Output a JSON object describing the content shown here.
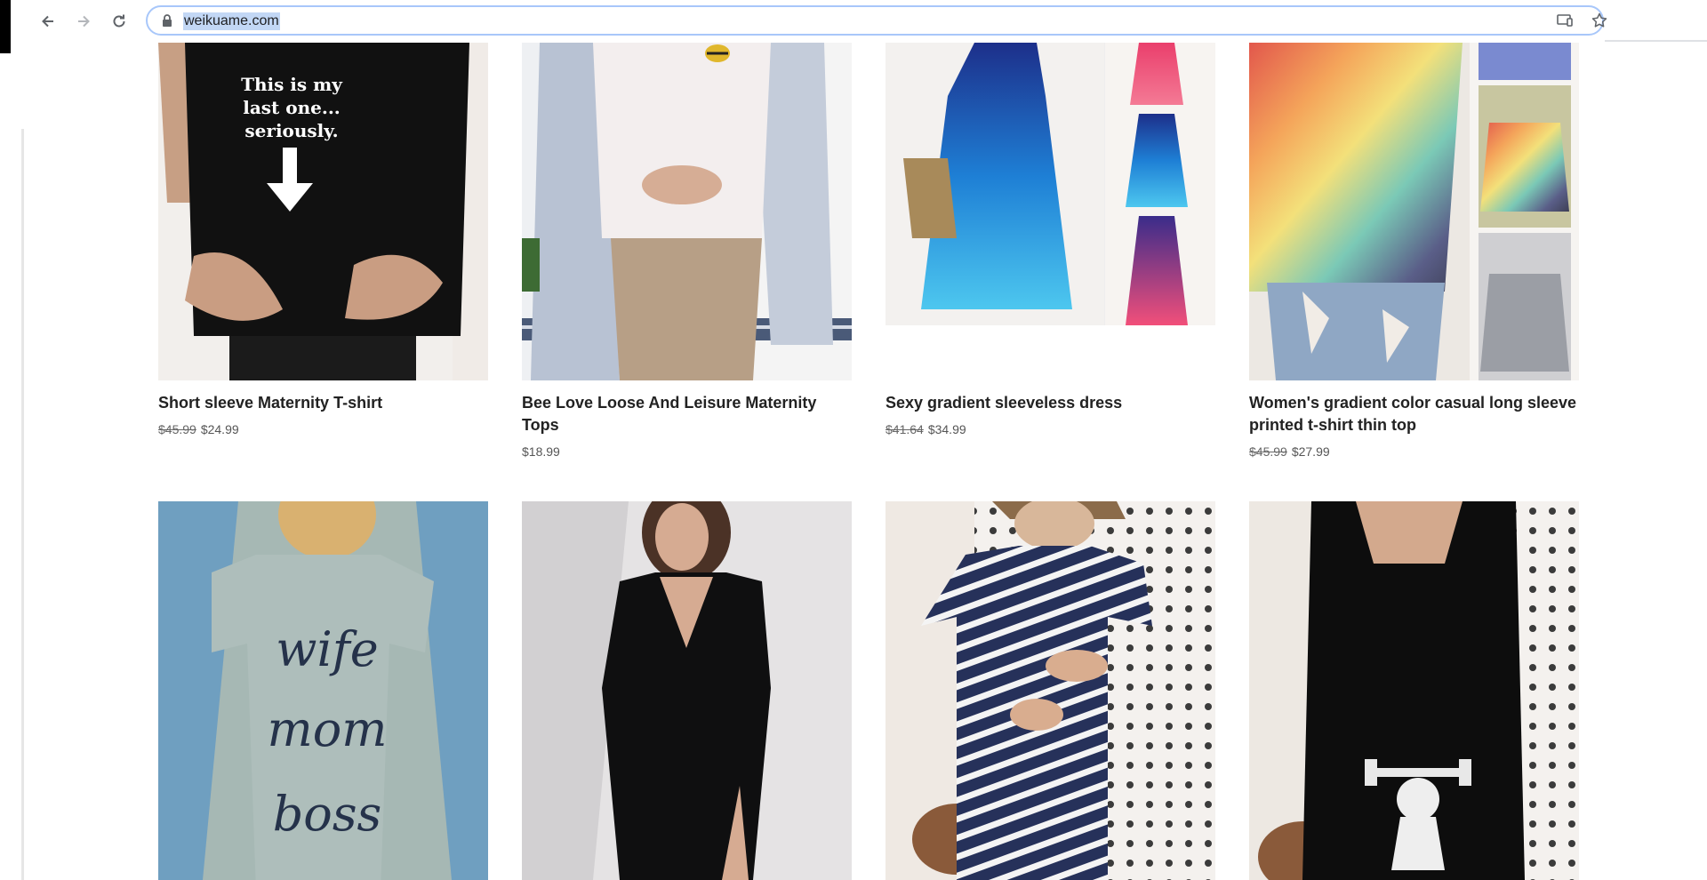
{
  "browser": {
    "url": "weikuame.com",
    "icons": {
      "back": "arrow-left-icon",
      "forward": "arrow-right-icon",
      "reload": "reload-icon",
      "lock": "lock-icon",
      "cast": "cast-icon",
      "bookmark": "star-icon"
    }
  },
  "products": [
    {
      "title": "Short sleeve Maternity T-shirt",
      "old_price": "$45.99",
      "price": "$24.99",
      "image_text": [
        "This is my",
        "last one...",
        "seriously."
      ]
    },
    {
      "title": "Bee Love Loose And Leisure Maternity Tops",
      "old_price": "",
      "price": "$18.99"
    },
    {
      "title": "Sexy gradient sleeveless dress",
      "old_price": "$41.64",
      "price": "$34.99"
    },
    {
      "title": "Women's gradient color casual long sleeve printed t-shirt thin top",
      "old_price": "$45.99",
      "price": "$27.99"
    },
    {
      "title": "",
      "image_text": [
        "wife",
        "mom",
        "boss"
      ]
    },
    {
      "title": ""
    },
    {
      "title": ""
    },
    {
      "title": ""
    }
  ],
  "colors": {
    "accent_focus": "#a8c7fa",
    "url_highlight": "#c2d7f5"
  }
}
